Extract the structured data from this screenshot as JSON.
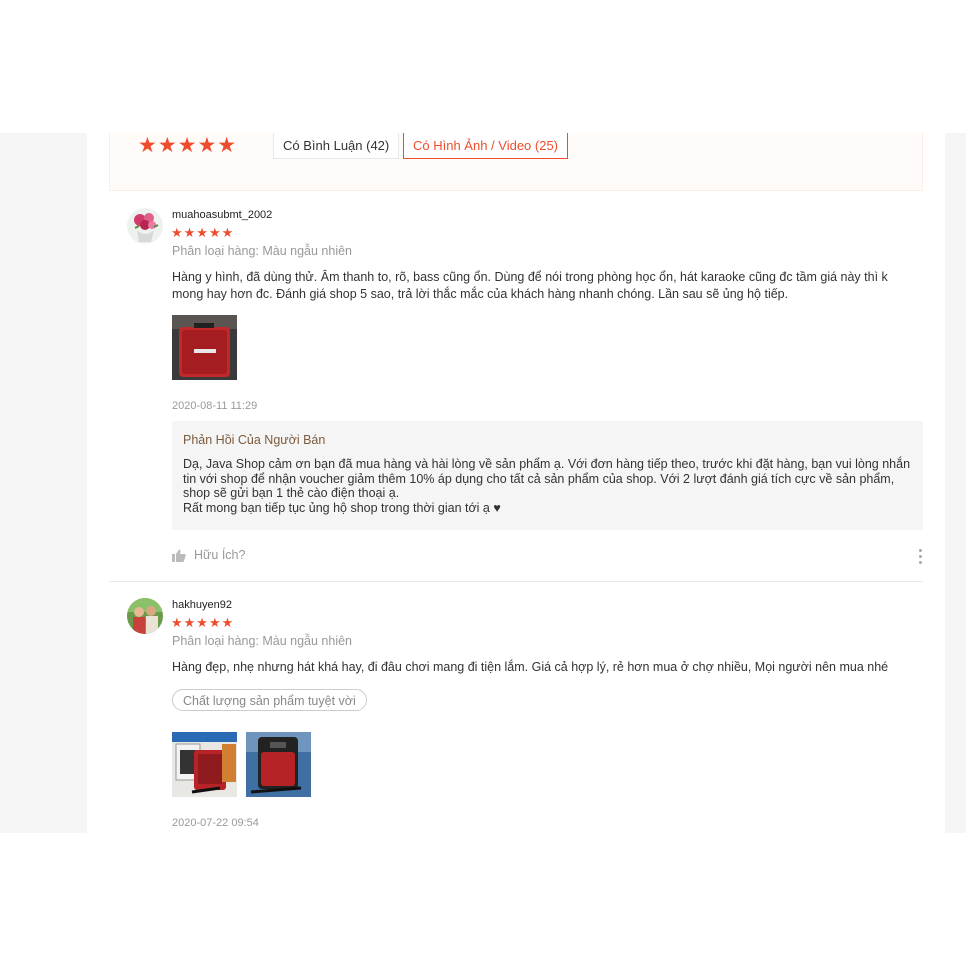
{
  "filters": {
    "rating_stars": "★★★★★",
    "comment_button": "Có Bình Luận (42)",
    "media_button": "Có Hình Ảnh / Video (25)"
  },
  "colors": {
    "accent": "#ee4d2d",
    "seller_title": "#7c5a3c"
  },
  "reviews": [
    {
      "username": "muahoasubmt_2002",
      "stars": "★★★★★",
      "variation": "Phân loại hàng: Màu ngẫu nhiên",
      "text": "Hàng y hình, đã dùng thử. Âm thanh to, rõ, bass cũng ổn. Dùng để nói trong phòng học ổn, hát karaoke cũng đc tầm giá này thì k mong hay hơn đc. Đánh giá shop 5 sao, trả lời thắc mắc của khách hàng nhanh chóng. Lần sau sẽ ủng hộ tiếp.",
      "time": "2020-08-11 11:29",
      "seller_reply": {
        "title": "Phản Hồi Của Người Bán",
        "text": "Dạ, Java Shop cảm ơn bạn đã mua hàng và hài lòng về sản phẩm ạ. Với đơn hàng tiếp theo, trước khi đặt hàng, bạn vui lòng nhắn tin với shop để nhận voucher giảm thêm 10% áp dụng cho tất cả sản phẩm của shop. Với 2 lượt đánh giá tích cực về sản phẩm, shop sẽ gửi bạn 1 thẻ cào điện thoại ạ.\nRất mong bạn tiếp tục ủng hộ shop trong thời gian tới ạ ♥"
      },
      "helpful": "Hữu Ích?"
    },
    {
      "username": "hakhuyen92",
      "stars": "★★★★★",
      "variation": "Phân loại hàng: Màu ngẫu nhiên",
      "text": "Hàng đẹp, nhẹ nhưng hát khá hay, đi đâu chơi mang đi tiện lắm. Giá cả hợp lý, rẻ hơn mua ở chợ nhiều, Mọi người nên mua nhé",
      "tag": "Chất lượng sản phẩm tuyệt vời",
      "time": "2020-07-22 09:54"
    }
  ]
}
